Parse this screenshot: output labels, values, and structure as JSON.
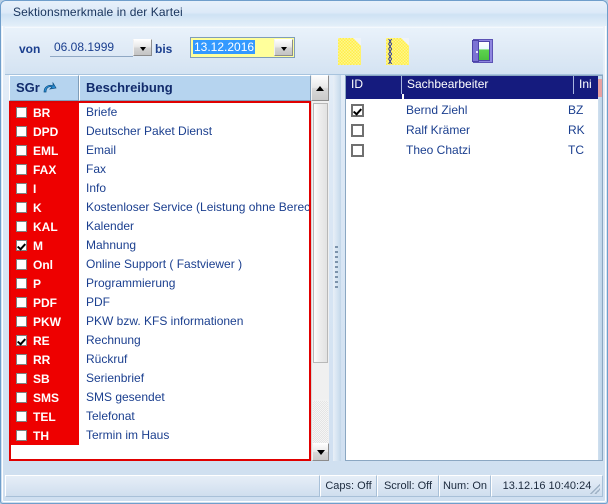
{
  "window": {
    "title": "Sektionsmerkmale in der Kartei"
  },
  "toolbar": {
    "from_label": "von",
    "from_value": "06.08.1999",
    "to_label": "bis",
    "to_value": "13.12.2016",
    "icons": [
      {
        "name": "new-document-icon",
        "glyph": "yellow-sheet"
      },
      {
        "name": "delete-document-icon",
        "glyph": "yellow-sheet-x",
        "marks": "X\nX\nX\nX\nX"
      },
      {
        "name": "exit-door-icon",
        "glyph": "door"
      }
    ]
  },
  "left_grid": {
    "headers": {
      "code": "SGr",
      "description": "Beschreibung"
    },
    "sort_indicator": "sort-arrow",
    "rows": [
      {
        "checked": false,
        "code": "BR",
        "description": "Briefe"
      },
      {
        "checked": false,
        "code": "DPD",
        "description": "Deutscher Paket Dienst"
      },
      {
        "checked": false,
        "code": "EML",
        "description": "Email"
      },
      {
        "checked": false,
        "code": "FAX",
        "description": "Fax"
      },
      {
        "checked": false,
        "code": "I",
        "description": "Info"
      },
      {
        "checked": false,
        "code": "K",
        "description": "Kostenloser Service (Leistung ohne Berechnu..."
      },
      {
        "checked": false,
        "code": "KAL",
        "description": "Kalender"
      },
      {
        "checked": true,
        "code": "M",
        "description": "Mahnung"
      },
      {
        "checked": false,
        "code": "Onl",
        "description": "Online Support ( Fastviewer )"
      },
      {
        "checked": false,
        "code": "P",
        "description": "Programmierung"
      },
      {
        "checked": false,
        "code": "PDF",
        "description": "PDF"
      },
      {
        "checked": false,
        "code": "PKW",
        "description": "PKW bzw. KFS informationen"
      },
      {
        "checked": true,
        "code": "RE",
        "description": "Rechnung"
      },
      {
        "checked": false,
        "code": "RR",
        "description": "Rückruf"
      },
      {
        "checked": false,
        "code": "SB",
        "description": "Serienbrief"
      },
      {
        "checked": false,
        "code": "SMS",
        "description": "SMS gesendet"
      },
      {
        "checked": false,
        "code": "TEL",
        "description": "Telefonat"
      },
      {
        "checked": false,
        "code": "TH",
        "description": "Termin im Haus"
      }
    ]
  },
  "right_grid": {
    "headers": {
      "id": "ID",
      "name": "Sachbearbeiter",
      "initials": "Ini"
    },
    "rows": [
      {
        "checked": true,
        "name": "Bernd Ziehl",
        "initials": "BZ"
      },
      {
        "checked": false,
        "name": "Ralf Krämer",
        "initials": "RK"
      },
      {
        "checked": false,
        "name": "Theo Chatzi",
        "initials": "TC"
      }
    ]
  },
  "statusbar": {
    "main": "",
    "caps": "Caps: Off",
    "scroll": "Scroll: Off",
    "num": "Num: On",
    "time": "13.12.16 10:40:24"
  },
  "colors": {
    "accent_red": "#ee0000",
    "header_blue": "#b6d4ef",
    "navy": "#151b7e",
    "text_blue": "#1b3f8f",
    "highlight_yellow": "#ffff9b",
    "selection_blue": "#3399ff"
  }
}
